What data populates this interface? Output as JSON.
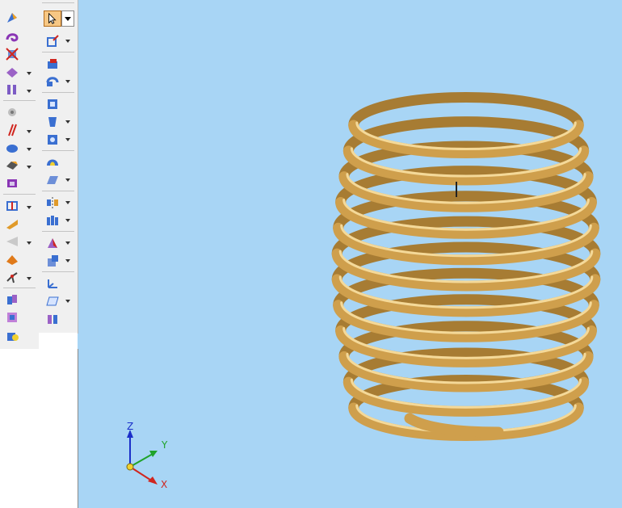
{
  "toolbar_left": {
    "tools": [
      {
        "name": "sweep-tool",
        "icon": "sweep-icon"
      },
      {
        "name": "helix-tool",
        "icon": "helix-icon"
      },
      {
        "name": "cut-tool",
        "icon": "cut-icon"
      },
      {
        "name": "thicken-tool",
        "icon": "thicken-icon"
      },
      {
        "name": "pattern-tool",
        "icon": "pattern-icon"
      },
      {
        "name": "hole-tool",
        "icon": "hole-icon"
      },
      {
        "name": "draft-tool",
        "icon": "draft-icon"
      },
      {
        "name": "round-tool",
        "icon": "round-icon"
      },
      {
        "name": "chamfer-tool",
        "icon": "chamfer-icon"
      },
      {
        "name": "shell-tool",
        "icon": "shell-icon"
      },
      {
        "name": "rib-tool",
        "icon": "rib-icon"
      },
      {
        "name": "lip-tool",
        "icon": "lip-icon"
      },
      {
        "name": "web-network-tool",
        "icon": "web-network-icon"
      },
      {
        "name": "mounting-boss-tool",
        "icon": "mounting-boss-icon"
      },
      {
        "name": "split-tool",
        "icon": "split-icon"
      },
      {
        "name": "union-tool",
        "icon": "union-icon"
      },
      {
        "name": "emboss-tool",
        "icon": "emboss-icon"
      },
      {
        "name": "part-copy-tool",
        "icon": "part-copy-icon"
      }
    ]
  },
  "toolbar_right": {
    "tools": [
      {
        "name": "select-tool",
        "icon": "cursor-icon"
      },
      {
        "name": "sketch-tool",
        "icon": "sketch-icon"
      },
      {
        "name": "protrusion-tool",
        "icon": "protrusion-icon"
      },
      {
        "name": "revolve-tool",
        "icon": "revolve-icon"
      },
      {
        "name": "extrude-cut-tool",
        "icon": "extrude-cut-icon"
      },
      {
        "name": "loft-tool",
        "icon": "loft-icon"
      },
      {
        "name": "normal-cut-tool",
        "icon": "normal-cut-icon"
      },
      {
        "name": "dome-tool",
        "icon": "dome-icon"
      },
      {
        "name": "surface-tool",
        "icon": "surface-icon"
      },
      {
        "name": "mirror-tool",
        "icon": "mirror-icon"
      },
      {
        "name": "feature-library-tool",
        "icon": "feature-library-icon"
      },
      {
        "name": "solid-sweep-tool",
        "icon": "solid-sweep-icon"
      },
      {
        "name": "coordinate-system-tool",
        "icon": "coordinate-system-icon"
      },
      {
        "name": "plane-tool",
        "icon": "plane-icon"
      },
      {
        "name": "replace-face-tool",
        "icon": "replace-face-icon"
      }
    ]
  },
  "viewport": {
    "background": "#a8d5f5",
    "model": {
      "name": "helical spring",
      "color": "#dcae5a"
    },
    "triad": {
      "x_label": "X",
      "y_label": "Y",
      "z_label": "Z",
      "x_color": "#d0261f",
      "y_color": "#1fa32a",
      "z_color": "#1b2fc9"
    }
  }
}
